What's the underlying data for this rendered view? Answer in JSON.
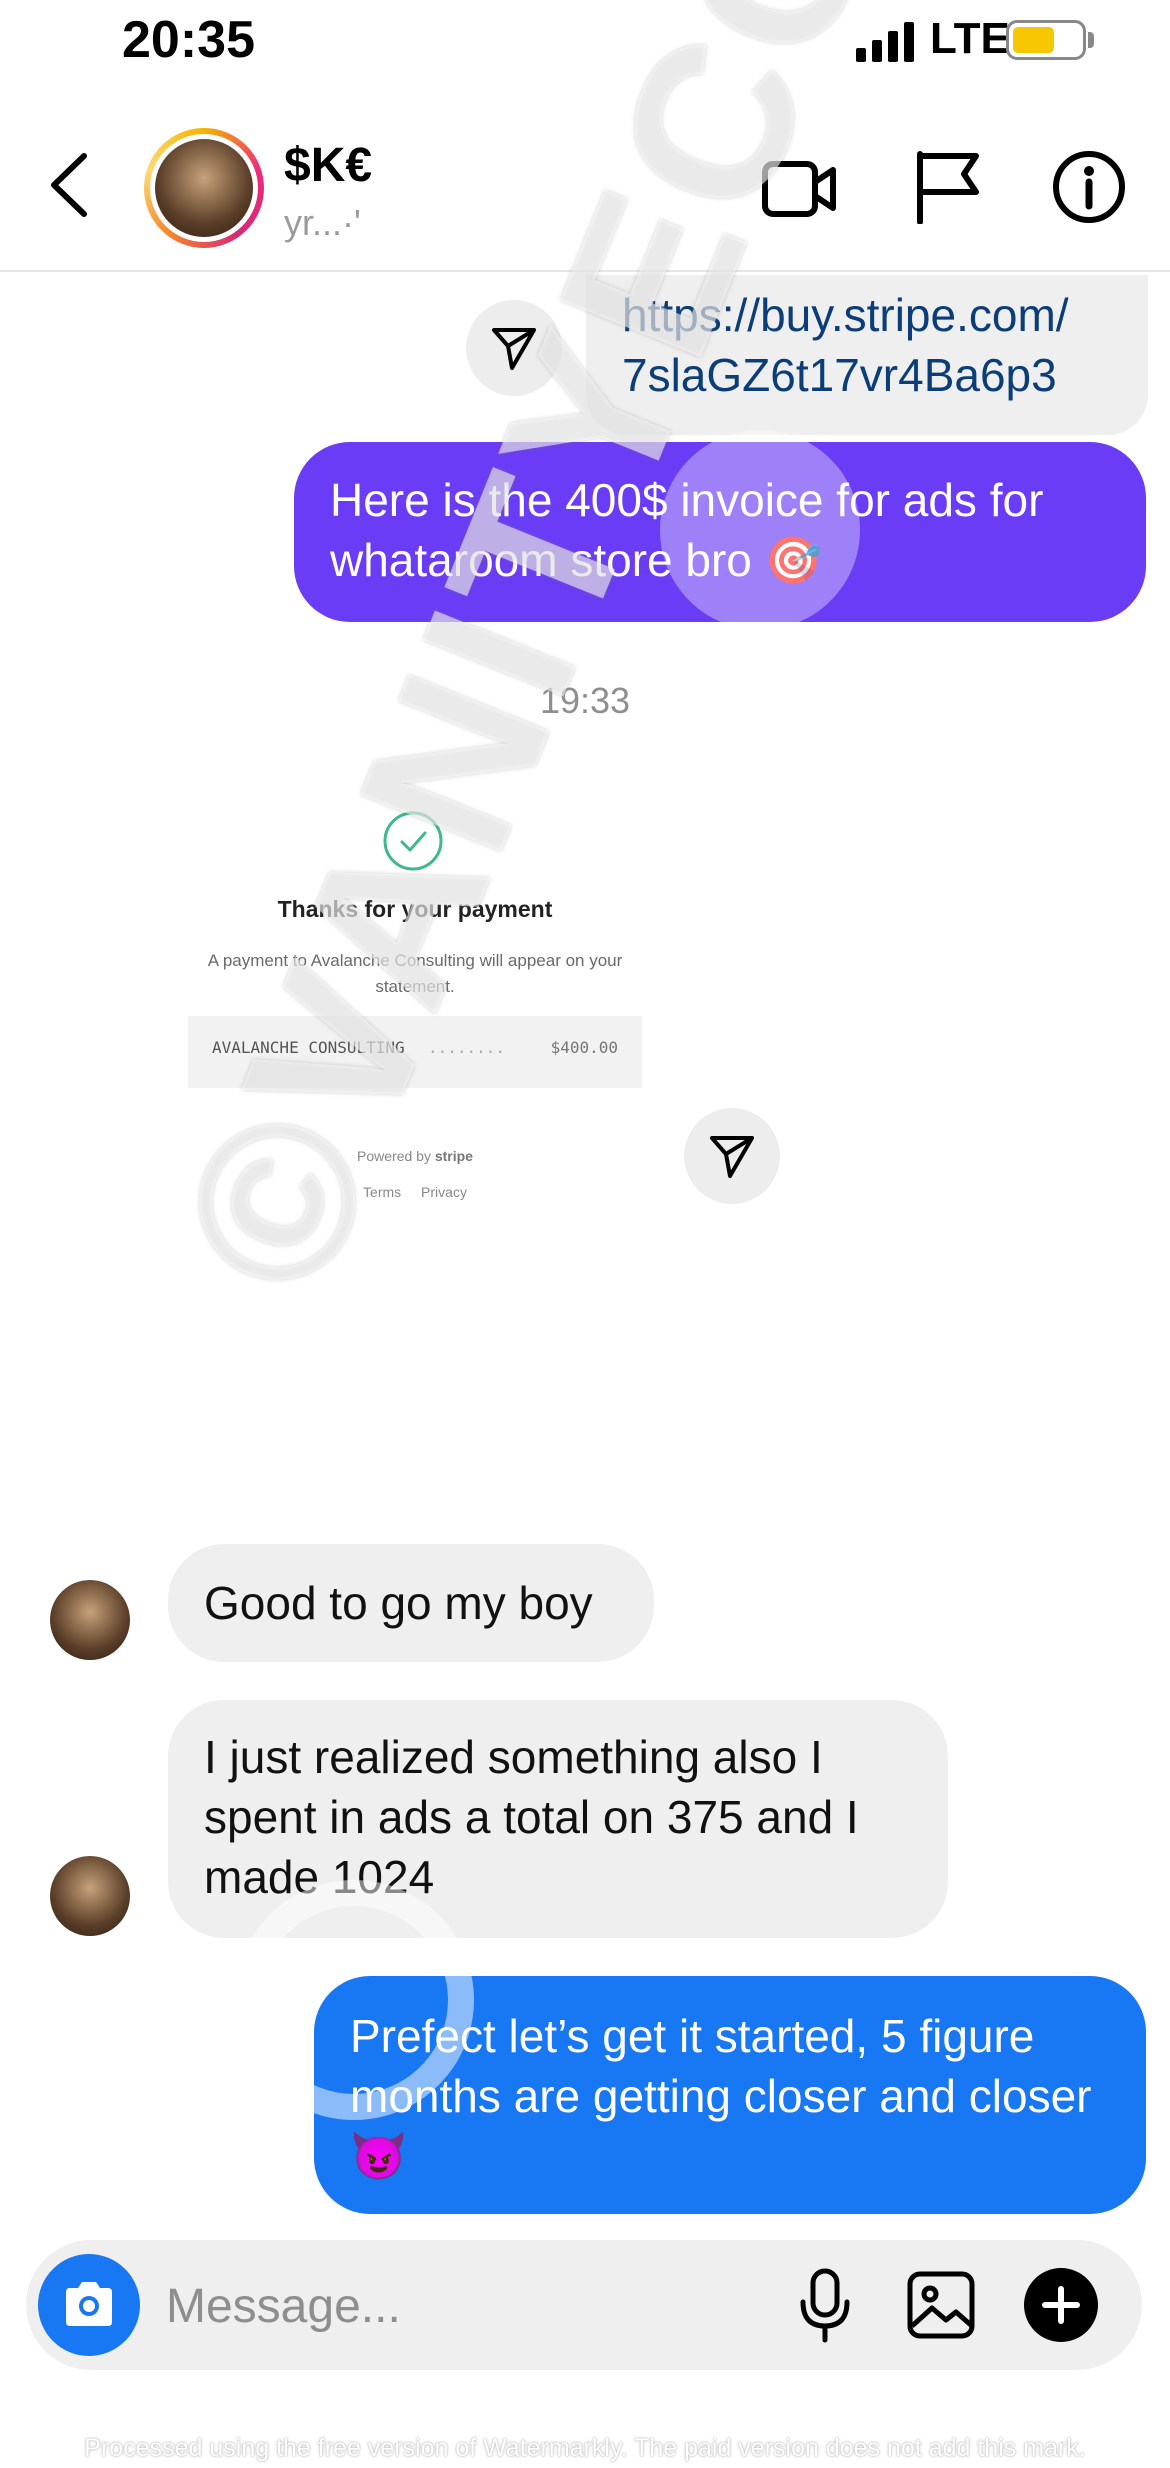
{
  "status_bar": {
    "time": "20:35",
    "network": "LTE",
    "battery_color": "#f6c603"
  },
  "header": {
    "name": "$K€",
    "subtitle": "yr...·'"
  },
  "messages": {
    "link_text": "https://buy.stripe.com/\n7slaGZ6t17vr4Ba6p3",
    "invoice_text": "Here is the 400$ invoice for ads for whataroom store bro 🎯",
    "timestamp": "19:33",
    "good_text": "Good to go my boy",
    "realized_text": "I just realized something also I spent in ads a total on 375 and I made 1024",
    "prefect_text": "Prefect let’s get it started, 5 figure months are getting closer and closer 😈"
  },
  "receipt": {
    "title": "Thanks for your payment",
    "description": "A payment to Avalanche Consulting will appear on your statement.",
    "merchant": "AVALANCHE CONSULTING",
    "dots": "........",
    "amount": "$400.00",
    "powered_by": "Powered by",
    "powered_brand": "stripe",
    "link_terms": "Terms",
    "link_privacy": "Privacy"
  },
  "composer": {
    "placeholder": "Message..."
  },
  "watermark": {
    "diagonal_text": "©VANITYECOM",
    "footer": "Processed using the free version of Watermarkly. The paid version does not add this mark."
  },
  "colors": {
    "sent_purple": "#6b3cf5",
    "sent_blue": "#1877f2",
    "received_gray": "#efefef",
    "link_blue": "#0b3d78"
  }
}
